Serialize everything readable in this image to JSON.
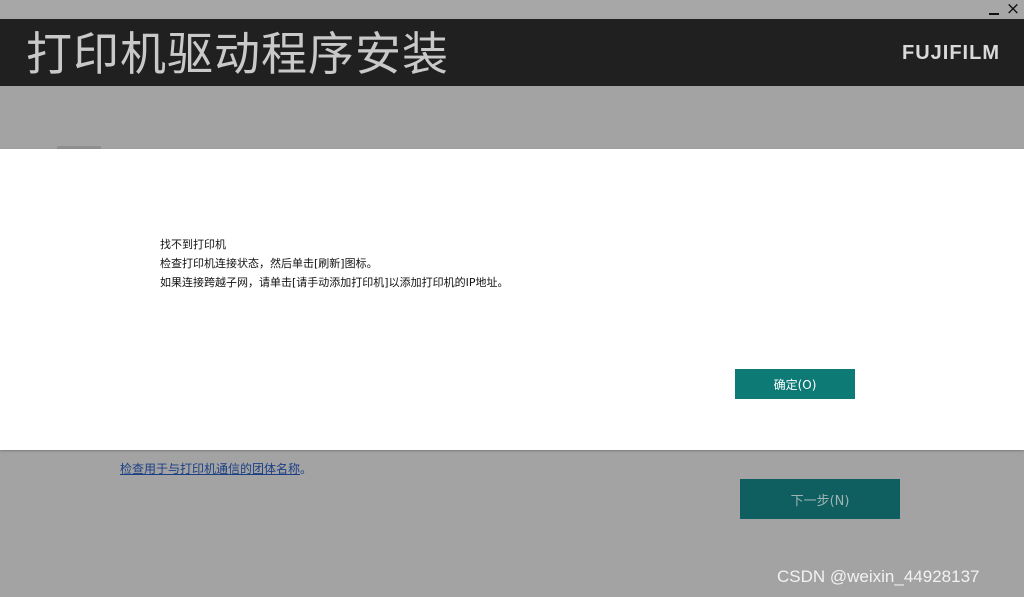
{
  "window": {
    "minimize_label": "_",
    "close_label": "×"
  },
  "header": {
    "title": "打印机驱动程序安装",
    "brand": "FUJIFILM"
  },
  "background": {
    "link_text": "检查用于与打印机通信的团体名称",
    "link_suffix": "。",
    "next_button_label": "下一步(N)"
  },
  "dialog": {
    "message_lines": [
      "找不到打印机",
      "检查打印机连接状态，然后单击[刷新]图标。",
      "如果连接跨越子网，请单击[请手动添加打印机]以添加打印机的IP地址。"
    ],
    "ok_button_label": "确定(O)"
  },
  "watermark": {
    "text": "CSDN @weixin_44928137"
  },
  "colors": {
    "header_bg": "#202020",
    "overlay_bg": "#a3a3a3",
    "ok_button_bg": "#0d7a75",
    "next_button_bg": "#0f5e60",
    "link_color": "#1c3f86"
  }
}
